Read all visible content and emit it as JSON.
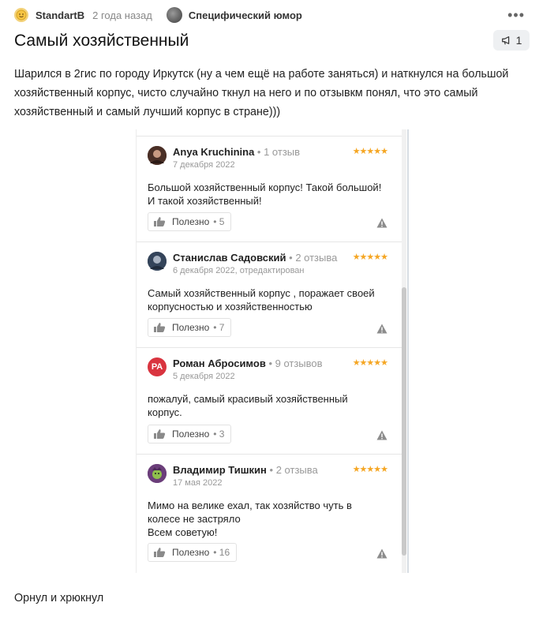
{
  "header": {
    "author": "StandartB",
    "time": "2 года назад",
    "community": "Специфический юмор",
    "more_icon": "more-dots-icon"
  },
  "post": {
    "title": "Самый хозяйственный",
    "badge_count": "1",
    "badge_icon": "megaphone-icon",
    "text": "Шарился в 2гис по городу Иркутск (ну а чем ещё на работе заняться) и наткнулся на большой хозяйственный корпус, чисто случайно ткнул на него и по отзывкм понял, что это самый хозяйственный и самый лучший корпус в стране)))",
    "footer": "Орнул и хрюкнул"
  },
  "reviews": [
    {
      "name": "Anya Kruchinina",
      "count": "1 отзыв",
      "date": "7 декабря 2022",
      "stars": "★★★★★",
      "text": "Большой хозяйственный корпус! Такой большой! И такой хозяйственный!",
      "helpful_label": "Полезно",
      "helpful_count": "5",
      "avatar_color": "#5a3a2e"
    },
    {
      "name": "Станислав Садовский",
      "count": "2 отзыва",
      "date": "6 декабря 2022, отредактирован",
      "stars": "★★★★★",
      "text": "Самый хозяйственный корпус , поражает своей корпусностью и хозяйственностью",
      "helpful_label": "Полезно",
      "helpful_count": "7",
      "avatar_color": "#3d4a5c"
    },
    {
      "name": "Роман Абросимов",
      "count": "9 отзывов",
      "date": "5 декабря 2022",
      "stars": "★★★★★",
      "text": "пожалуй, самый красивый хозяйственный корпус.",
      "helpful_label": "Полезно",
      "helpful_count": "3",
      "avatar_text": "РА",
      "avatar_color": "#d9343f"
    },
    {
      "name": "Владимир Тишкин",
      "count": "2 отзыва",
      "date": "17 мая 2022",
      "stars": "★★★★★",
      "text": "Мимо на велике ехал, так хозяйство чуть в колесе не застряло\nВсем советую!",
      "helpful_label": "Полезно",
      "helpful_count": "16",
      "avatar_color": "#6b3e7a"
    }
  ],
  "colors": {
    "stars": "#f5a623",
    "accent_avatar": "#d9343f"
  }
}
